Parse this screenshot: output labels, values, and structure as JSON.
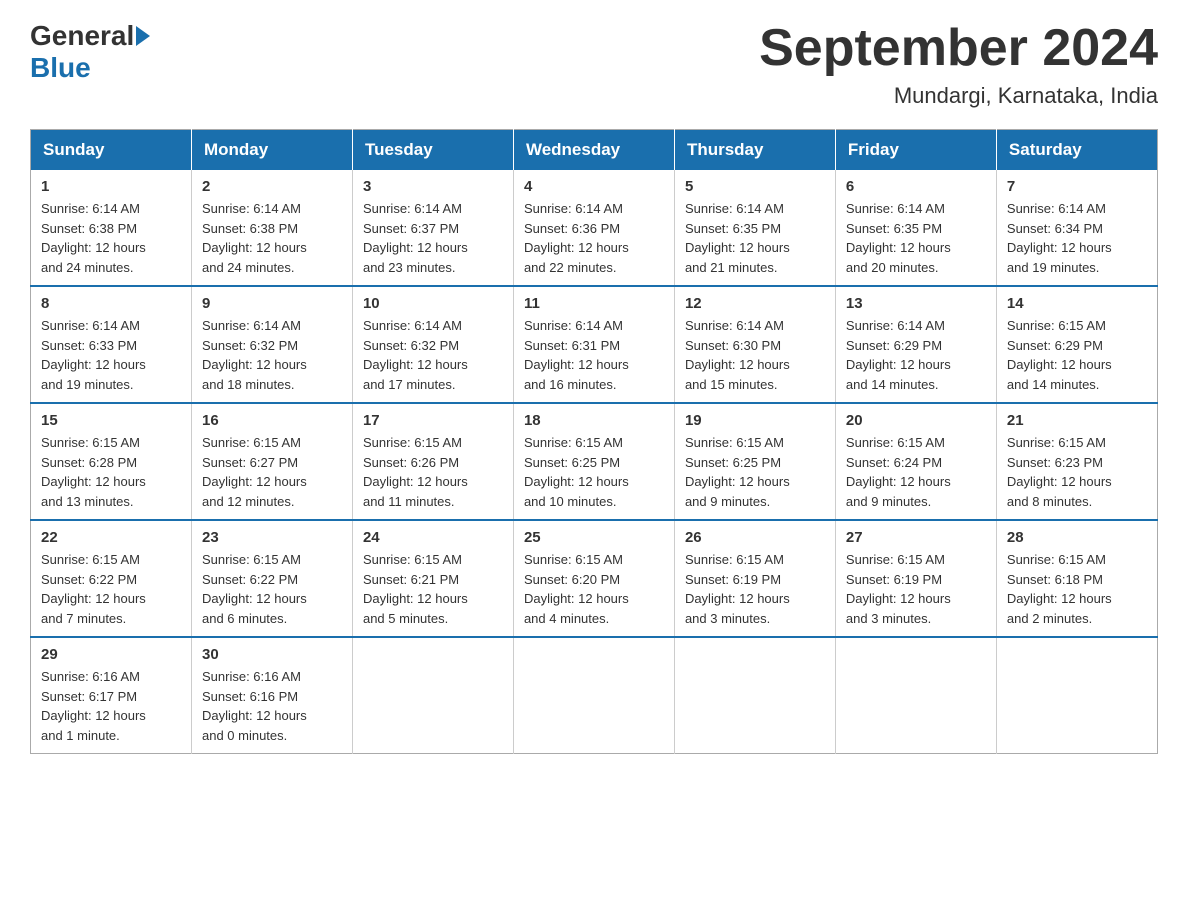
{
  "logo": {
    "text_before": "General",
    "text_after": "Blue"
  },
  "title": "September 2024",
  "subtitle": "Mundargi, Karnataka, India",
  "days_of_week": [
    "Sunday",
    "Monday",
    "Tuesday",
    "Wednesday",
    "Thursday",
    "Friday",
    "Saturday"
  ],
  "weeks": [
    [
      {
        "day": "1",
        "sunrise": "6:14 AM",
        "sunset": "6:38 PM",
        "daylight": "12 hours and 24 minutes."
      },
      {
        "day": "2",
        "sunrise": "6:14 AM",
        "sunset": "6:38 PM",
        "daylight": "12 hours and 24 minutes."
      },
      {
        "day": "3",
        "sunrise": "6:14 AM",
        "sunset": "6:37 PM",
        "daylight": "12 hours and 23 minutes."
      },
      {
        "day": "4",
        "sunrise": "6:14 AM",
        "sunset": "6:36 PM",
        "daylight": "12 hours and 22 minutes."
      },
      {
        "day": "5",
        "sunrise": "6:14 AM",
        "sunset": "6:35 PM",
        "daylight": "12 hours and 21 minutes."
      },
      {
        "day": "6",
        "sunrise": "6:14 AM",
        "sunset": "6:35 PM",
        "daylight": "12 hours and 20 minutes."
      },
      {
        "day": "7",
        "sunrise": "6:14 AM",
        "sunset": "6:34 PM",
        "daylight": "12 hours and 19 minutes."
      }
    ],
    [
      {
        "day": "8",
        "sunrise": "6:14 AM",
        "sunset": "6:33 PM",
        "daylight": "12 hours and 19 minutes."
      },
      {
        "day": "9",
        "sunrise": "6:14 AM",
        "sunset": "6:32 PM",
        "daylight": "12 hours and 18 minutes."
      },
      {
        "day": "10",
        "sunrise": "6:14 AM",
        "sunset": "6:32 PM",
        "daylight": "12 hours and 17 minutes."
      },
      {
        "day": "11",
        "sunrise": "6:14 AM",
        "sunset": "6:31 PM",
        "daylight": "12 hours and 16 minutes."
      },
      {
        "day": "12",
        "sunrise": "6:14 AM",
        "sunset": "6:30 PM",
        "daylight": "12 hours and 15 minutes."
      },
      {
        "day": "13",
        "sunrise": "6:14 AM",
        "sunset": "6:29 PM",
        "daylight": "12 hours and 14 minutes."
      },
      {
        "day": "14",
        "sunrise": "6:15 AM",
        "sunset": "6:29 PM",
        "daylight": "12 hours and 14 minutes."
      }
    ],
    [
      {
        "day": "15",
        "sunrise": "6:15 AM",
        "sunset": "6:28 PM",
        "daylight": "12 hours and 13 minutes."
      },
      {
        "day": "16",
        "sunrise": "6:15 AM",
        "sunset": "6:27 PM",
        "daylight": "12 hours and 12 minutes."
      },
      {
        "day": "17",
        "sunrise": "6:15 AM",
        "sunset": "6:26 PM",
        "daylight": "12 hours and 11 minutes."
      },
      {
        "day": "18",
        "sunrise": "6:15 AM",
        "sunset": "6:25 PM",
        "daylight": "12 hours and 10 minutes."
      },
      {
        "day": "19",
        "sunrise": "6:15 AM",
        "sunset": "6:25 PM",
        "daylight": "12 hours and 9 minutes."
      },
      {
        "day": "20",
        "sunrise": "6:15 AM",
        "sunset": "6:24 PM",
        "daylight": "12 hours and 9 minutes."
      },
      {
        "day": "21",
        "sunrise": "6:15 AM",
        "sunset": "6:23 PM",
        "daylight": "12 hours and 8 minutes."
      }
    ],
    [
      {
        "day": "22",
        "sunrise": "6:15 AM",
        "sunset": "6:22 PM",
        "daylight": "12 hours and 7 minutes."
      },
      {
        "day": "23",
        "sunrise": "6:15 AM",
        "sunset": "6:22 PM",
        "daylight": "12 hours and 6 minutes."
      },
      {
        "day": "24",
        "sunrise": "6:15 AM",
        "sunset": "6:21 PM",
        "daylight": "12 hours and 5 minutes."
      },
      {
        "day": "25",
        "sunrise": "6:15 AM",
        "sunset": "6:20 PM",
        "daylight": "12 hours and 4 minutes."
      },
      {
        "day": "26",
        "sunrise": "6:15 AM",
        "sunset": "6:19 PM",
        "daylight": "12 hours and 3 minutes."
      },
      {
        "day": "27",
        "sunrise": "6:15 AM",
        "sunset": "6:19 PM",
        "daylight": "12 hours and 3 minutes."
      },
      {
        "day": "28",
        "sunrise": "6:15 AM",
        "sunset": "6:18 PM",
        "daylight": "12 hours and 2 minutes."
      }
    ],
    [
      {
        "day": "29",
        "sunrise": "6:16 AM",
        "sunset": "6:17 PM",
        "daylight": "12 hours and 1 minute."
      },
      {
        "day": "30",
        "sunrise": "6:16 AM",
        "sunset": "6:16 PM",
        "daylight": "12 hours and 0 minutes."
      },
      null,
      null,
      null,
      null,
      null
    ]
  ],
  "labels": {
    "sunrise": "Sunrise:",
    "sunset": "Sunset:",
    "daylight": "Daylight:"
  }
}
